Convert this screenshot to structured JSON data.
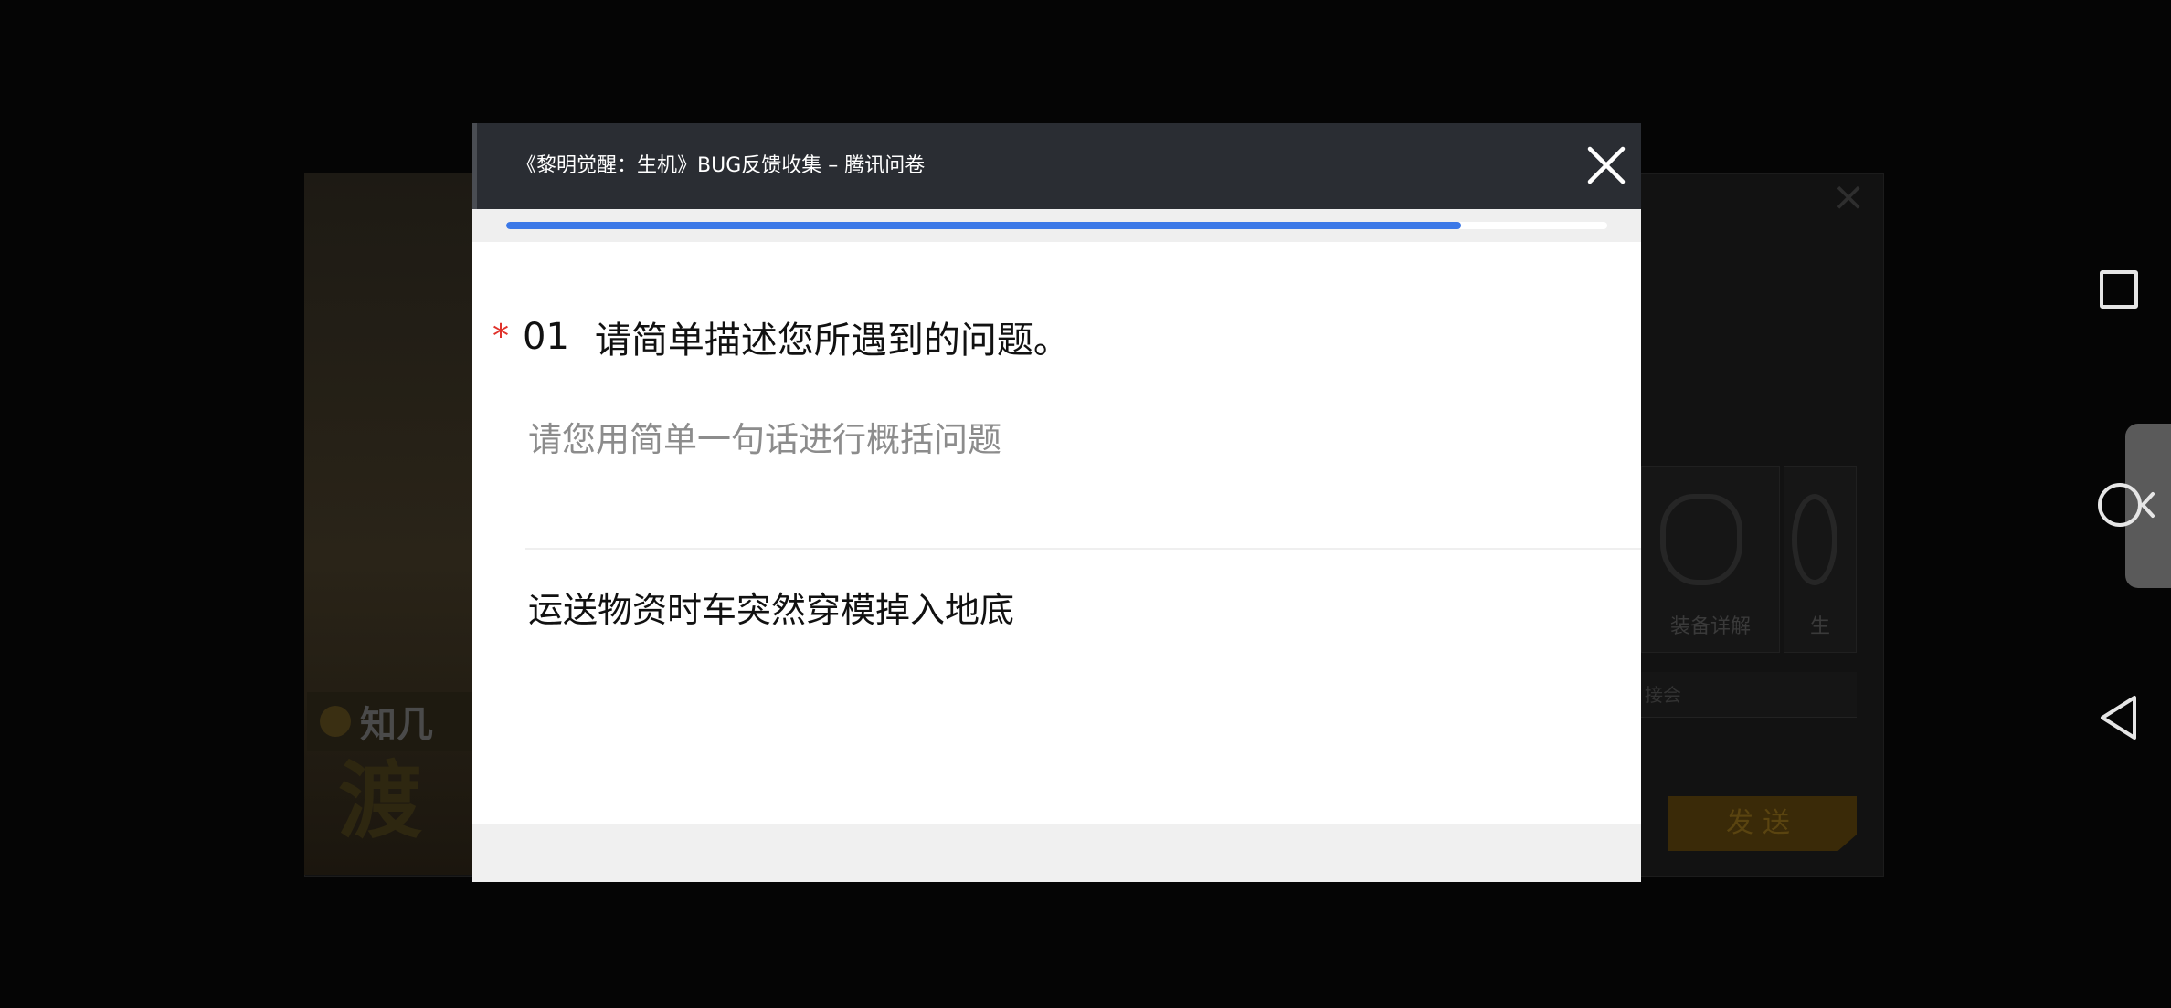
{
  "background_app": {
    "banner_label": "知几",
    "banner_title": "渡",
    "cards": [
      {
        "caption": "装备详解"
      },
      {
        "caption": "生"
      }
    ],
    "input_hint": "接会",
    "send_label": "发送"
  },
  "dialog": {
    "title": "《黎明觉醒：生机》BUG反馈收集 – 腾讯问卷",
    "progress_fraction": 0.867,
    "colors": {
      "header_bg": "#2a2d33",
      "progress_fill": "#3b78e7",
      "required_star": "#e0322b"
    },
    "question": {
      "required_marker": "*",
      "number": "01",
      "text": "请简单描述您所遇到的问题。",
      "description": "请您用简单一句话进行概括问题",
      "answer_value": "运送物资时车突然穿模掉入地底"
    }
  },
  "system_nav": {
    "icons": [
      "recents-square-icon",
      "home-circle-icon",
      "back-triangle-icon",
      "chevron-left-icon"
    ]
  }
}
